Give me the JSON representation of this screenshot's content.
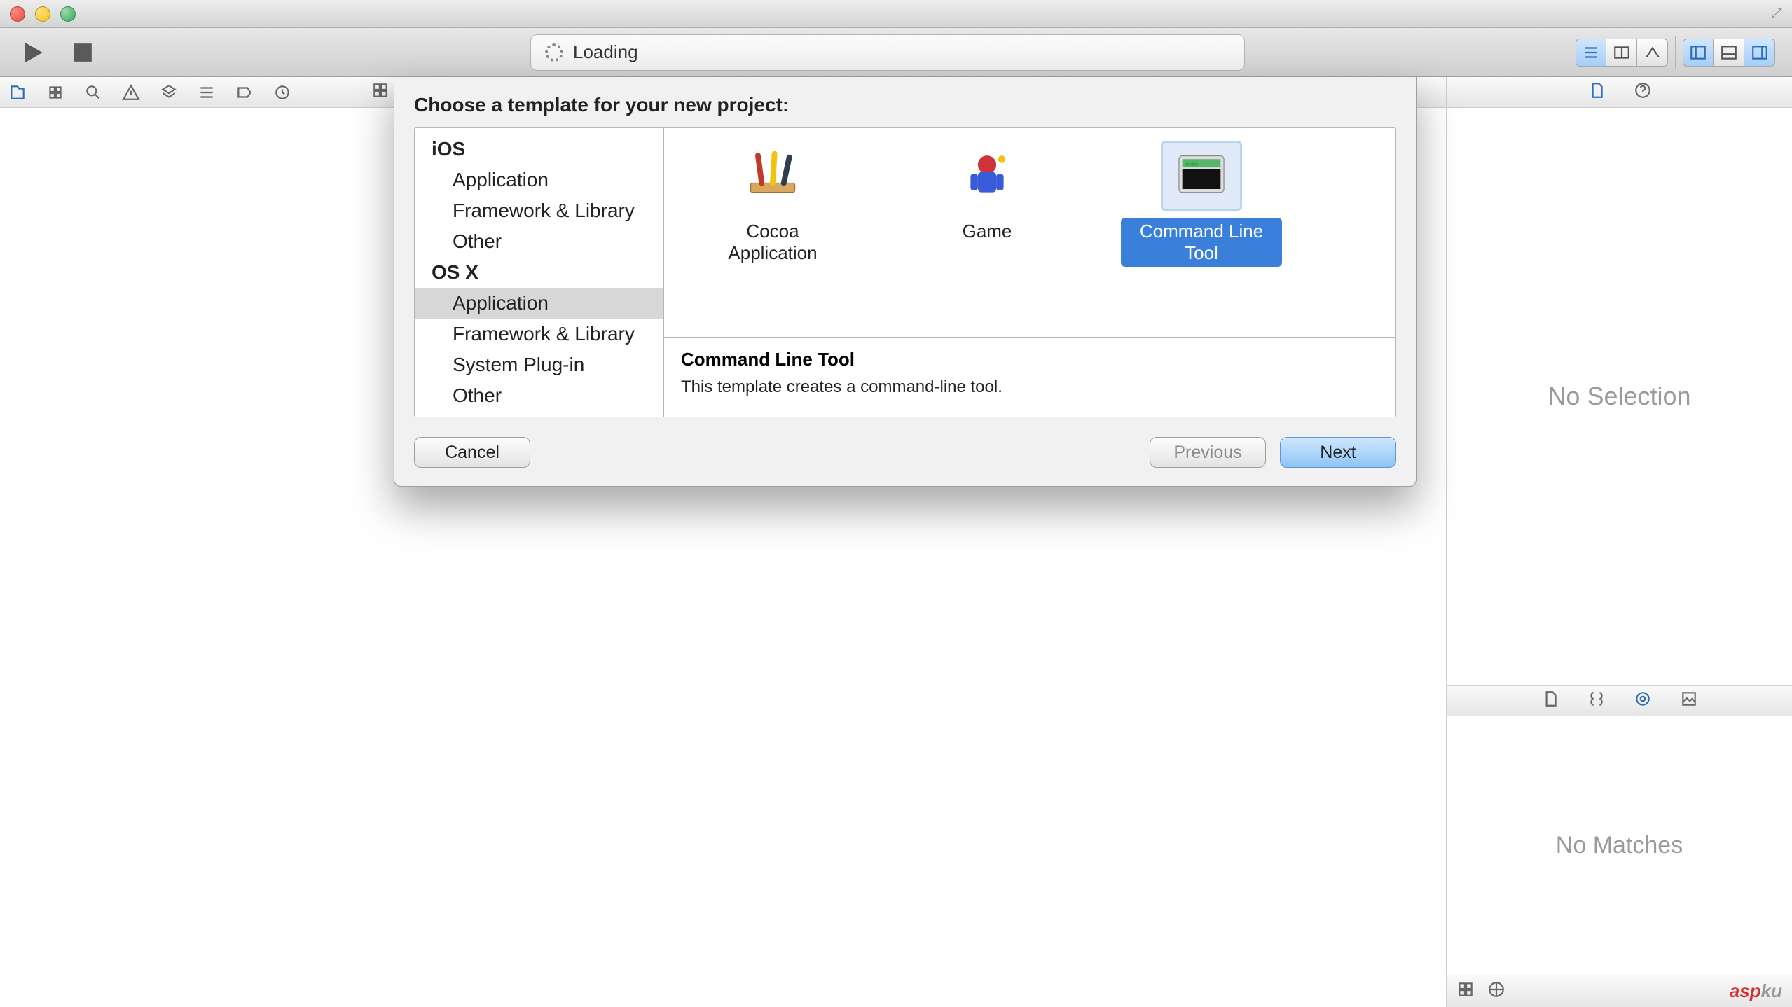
{
  "toolbar": {
    "status_text": "Loading"
  },
  "sheet": {
    "title": "Choose a template for your new project:",
    "categories": [
      {
        "header": "iOS"
      },
      {
        "item": "Application"
      },
      {
        "item": "Framework & Library"
      },
      {
        "item": "Other"
      },
      {
        "header": "OS X"
      },
      {
        "item": "Application",
        "selected": true
      },
      {
        "item": "Framework & Library"
      },
      {
        "item": "System Plug-in"
      },
      {
        "item": "Other"
      }
    ],
    "templates": [
      {
        "name": "Cocoa Application",
        "icon": "cocoa-app-icon"
      },
      {
        "name": "Game",
        "icon": "game-icon"
      },
      {
        "name": "Command Line Tool",
        "icon": "cli-icon",
        "selected": true
      }
    ],
    "detail_title": "Command Line Tool",
    "detail_text": "This template creates a command-line tool.",
    "buttons": {
      "cancel": "Cancel",
      "previous": "Previous",
      "next": "Next"
    }
  },
  "inspector": {
    "no_selection": "No Selection",
    "no_matches": "No Matches"
  },
  "watermark": {
    "a": "asp",
    "b": "ku"
  }
}
